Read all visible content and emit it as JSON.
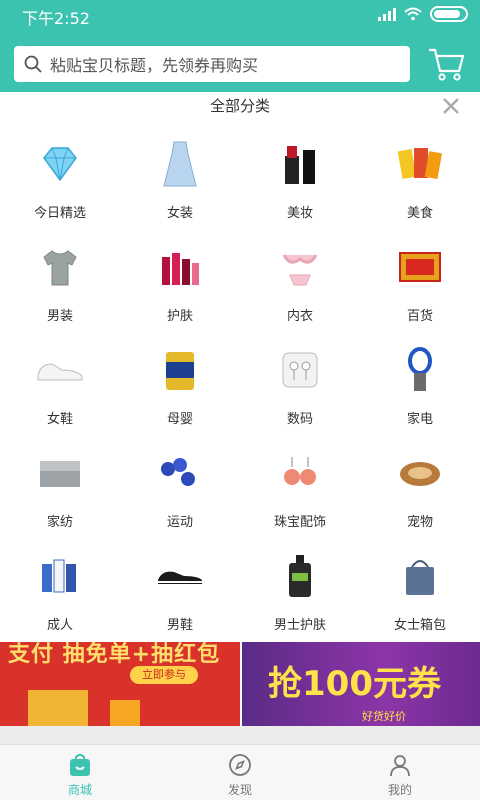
{
  "status_bar": {
    "time": "下午2:52"
  },
  "search": {
    "placeholder": "粘贴宝贝标题，先领券再购买"
  },
  "panel": {
    "title": "全部分类"
  },
  "categories": [
    {
      "label": "今日精选",
      "icon": "diamond-icon"
    },
    {
      "label": "女装",
      "icon": "dress-icon"
    },
    {
      "label": "美妆",
      "icon": "lipstick-icon"
    },
    {
      "label": "美食",
      "icon": "snacks-icon"
    },
    {
      "label": "男装",
      "icon": "tshirt-icon"
    },
    {
      "label": "护肤",
      "icon": "skincare-icon"
    },
    {
      "label": "内衣",
      "icon": "lingerie-icon"
    },
    {
      "label": "百货",
      "icon": "goods-icon"
    },
    {
      "label": "女鞋",
      "icon": "sneaker-icon"
    },
    {
      "label": "母婴",
      "icon": "formula-can-icon"
    },
    {
      "label": "数码",
      "icon": "earphones-icon"
    },
    {
      "label": "家电",
      "icon": "fan-icon"
    },
    {
      "label": "家纺",
      "icon": "bedding-icon"
    },
    {
      "label": "运动",
      "icon": "dumbbell-icon"
    },
    {
      "label": "珠宝配饰",
      "icon": "earring-icon"
    },
    {
      "label": "宠物",
      "icon": "pet-bed-icon"
    },
    {
      "label": "成人",
      "icon": "adult-products-icon"
    },
    {
      "label": "男鞋",
      "icon": "mens-shoe-icon"
    },
    {
      "label": "男士护肤",
      "icon": "cleanser-icon"
    },
    {
      "label": "女士箱包",
      "icon": "bag-icon"
    }
  ],
  "banners": [
    {
      "headline": "支付 抽免单+抽红包",
      "cta": "立即参与"
    },
    {
      "headline": "抢100元券",
      "sub": "好货好价"
    }
  ],
  "tabs": [
    {
      "label": "商城",
      "icon": "shopping-bag-icon",
      "active": true
    },
    {
      "label": "发现",
      "icon": "compass-icon",
      "active": false
    },
    {
      "label": "我的",
      "icon": "user-icon",
      "active": false
    }
  ],
  "colors": {
    "accent": "#3cc3b0"
  }
}
